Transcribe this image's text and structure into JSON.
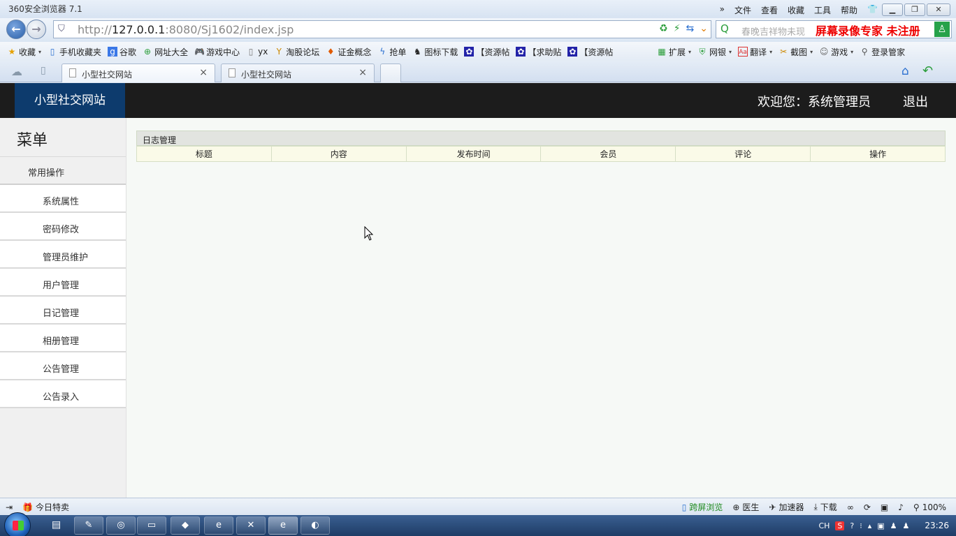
{
  "browser": {
    "app_title": "360安全浏览器 7.1",
    "menus": [
      "»",
      "文件",
      "查看",
      "收藏",
      "工具",
      "帮助"
    ],
    "url_prefix": "http://",
    "url_host": "127.0.0.1",
    "url_rest": ":8080/Sj1602/index.jsp",
    "search_hint": "春晚吉祥物未现",
    "watermark": "屏幕录像专家  未注册",
    "bookmarks": [
      {
        "label": "收藏",
        "icon": "star-icon",
        "caret": "▾"
      },
      {
        "label": "手机收藏夹",
        "icon": "phone-icon"
      },
      {
        "label": "谷歌",
        "icon": "google-icon"
      },
      {
        "label": "网址大全",
        "icon": "globe-icon"
      },
      {
        "label": "游戏中心",
        "icon": "gamepad-icon"
      },
      {
        "label": "yx",
        "icon": "page-icon"
      },
      {
        "label": "淘股论坛",
        "icon": "forum-icon"
      },
      {
        "label": "证金概念",
        "icon": "chart-icon"
      },
      {
        "label": "抢单",
        "icon": "bolt-icon"
      },
      {
        "label": "图标下载",
        "icon": "penguin-icon"
      },
      {
        "label": "【资源帖",
        "icon": "paw-icon"
      },
      {
        "label": "【求助贴",
        "icon": "paw-icon"
      },
      {
        "label": "【资源帖",
        "icon": "paw-icon"
      }
    ],
    "bookmarks_right": [
      {
        "label": "扩展",
        "icon": "grid-icon",
        "caret": "▾"
      },
      {
        "label": "网银",
        "icon": "bank-icon",
        "caret": "▾"
      },
      {
        "label": "翻译",
        "icon": "translate-icon",
        "caret": "▾"
      },
      {
        "label": "截图",
        "icon": "scissors-icon",
        "caret": "▾"
      },
      {
        "label": "游戏",
        "icon": "game-icon",
        "caret": "▾"
      },
      {
        "label": "登录管家",
        "icon": "key-icon"
      }
    ],
    "tabs": [
      {
        "label": "小型社交网站",
        "active": true
      },
      {
        "label": "小型社交网站",
        "active": false
      }
    ],
    "status_left": "今日特卖",
    "status_right": [
      {
        "label": "跨屏浏览",
        "icon": "screen-icon"
      },
      {
        "label": "医生",
        "icon": "doctor-icon"
      },
      {
        "label": "加速器",
        "icon": "rocket-icon"
      },
      {
        "label": "下载",
        "icon": "download-icon"
      },
      {
        "label": "100%",
        "icon": "zoom-icon"
      }
    ]
  },
  "site": {
    "brand": "小型社交网站",
    "welcome": "欢迎您：系统管理员",
    "logout": "退出",
    "menu_title": "菜单",
    "menu_group": "常用操作",
    "menu_items": [
      "系统属性",
      "密码修改",
      "管理员维护",
      "用户管理",
      "日记管理",
      "相册管理",
      "公告管理",
      "公告录入"
    ],
    "panel_title": "日志管理",
    "columns": [
      "标题",
      "内容",
      "发布时间",
      "会员",
      "评论",
      "操作"
    ]
  },
  "taskbar": {
    "tray_lang": "CH",
    "clock": "23:26"
  }
}
